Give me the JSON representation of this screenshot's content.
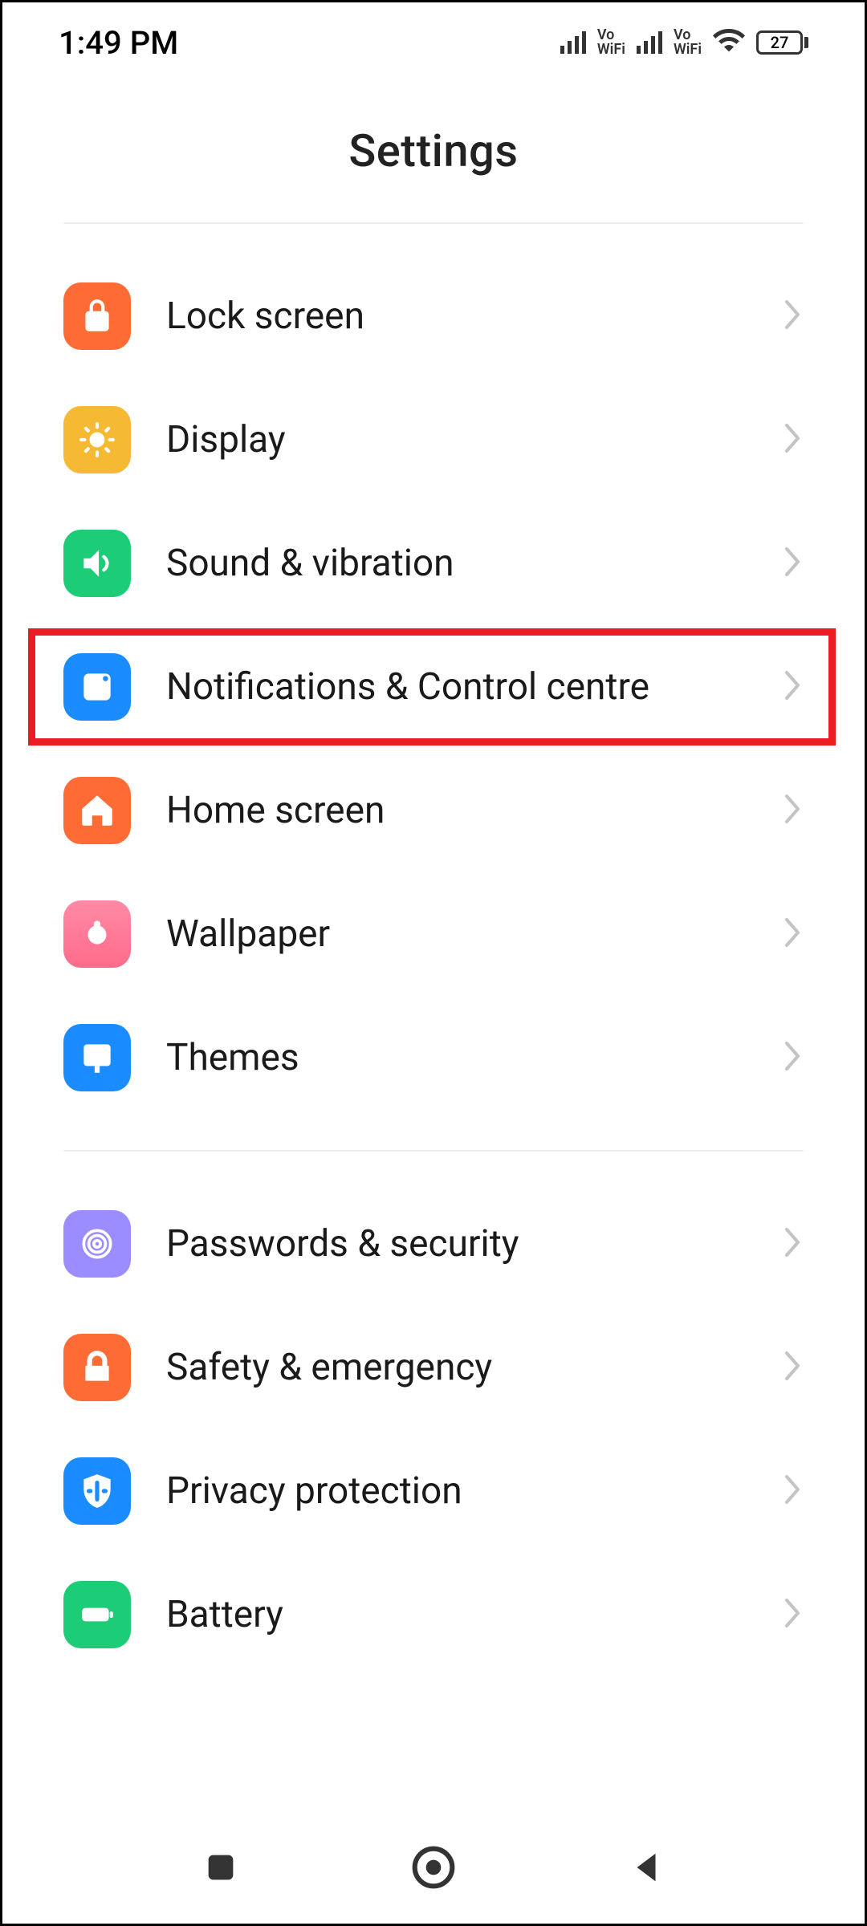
{
  "status": {
    "time": "1:49 PM",
    "vowifi": "Vo\nWiFi",
    "battery_level": "27"
  },
  "header": {
    "title": "Settings"
  },
  "groups": [
    {
      "items": [
        {
          "id": "lock-screen",
          "label": "Lock screen",
          "icon": "lock-icon",
          "color": "bg-orange",
          "highlighted": false
        },
        {
          "id": "display",
          "label": "Display",
          "icon": "sun-icon",
          "color": "bg-yellow",
          "highlighted": false
        },
        {
          "id": "sound-vibration",
          "label": "Sound & vibration",
          "icon": "sound-icon",
          "color": "bg-green",
          "highlighted": false
        },
        {
          "id": "notifications-control",
          "label": "Notifications & Control centre",
          "icon": "notification-icon",
          "color": "bg-blue",
          "highlighted": true
        },
        {
          "id": "home-screen",
          "label": "Home screen",
          "icon": "home-icon",
          "color": "bg-orange",
          "highlighted": false
        },
        {
          "id": "wallpaper",
          "label": "Wallpaper",
          "icon": "wallpaper-icon",
          "color": "bg-pink",
          "highlighted": false
        },
        {
          "id": "themes",
          "label": "Themes",
          "icon": "themes-icon",
          "color": "bg-blue",
          "highlighted": false
        }
      ]
    },
    {
      "items": [
        {
          "id": "passwords-security",
          "label": "Passwords & security",
          "icon": "fingerprint-icon",
          "color": "bg-purple",
          "highlighted": false
        },
        {
          "id": "safety-emergency",
          "label": "Safety & emergency",
          "icon": "safety-icon",
          "color": "bg-orange",
          "highlighted": false
        },
        {
          "id": "privacy-protection",
          "label": "Privacy protection",
          "icon": "privacy-icon",
          "color": "bg-blue",
          "highlighted": false
        },
        {
          "id": "battery",
          "label": "Battery",
          "icon": "battery-icon",
          "color": "bg-green2",
          "highlighted": false
        }
      ]
    }
  ]
}
